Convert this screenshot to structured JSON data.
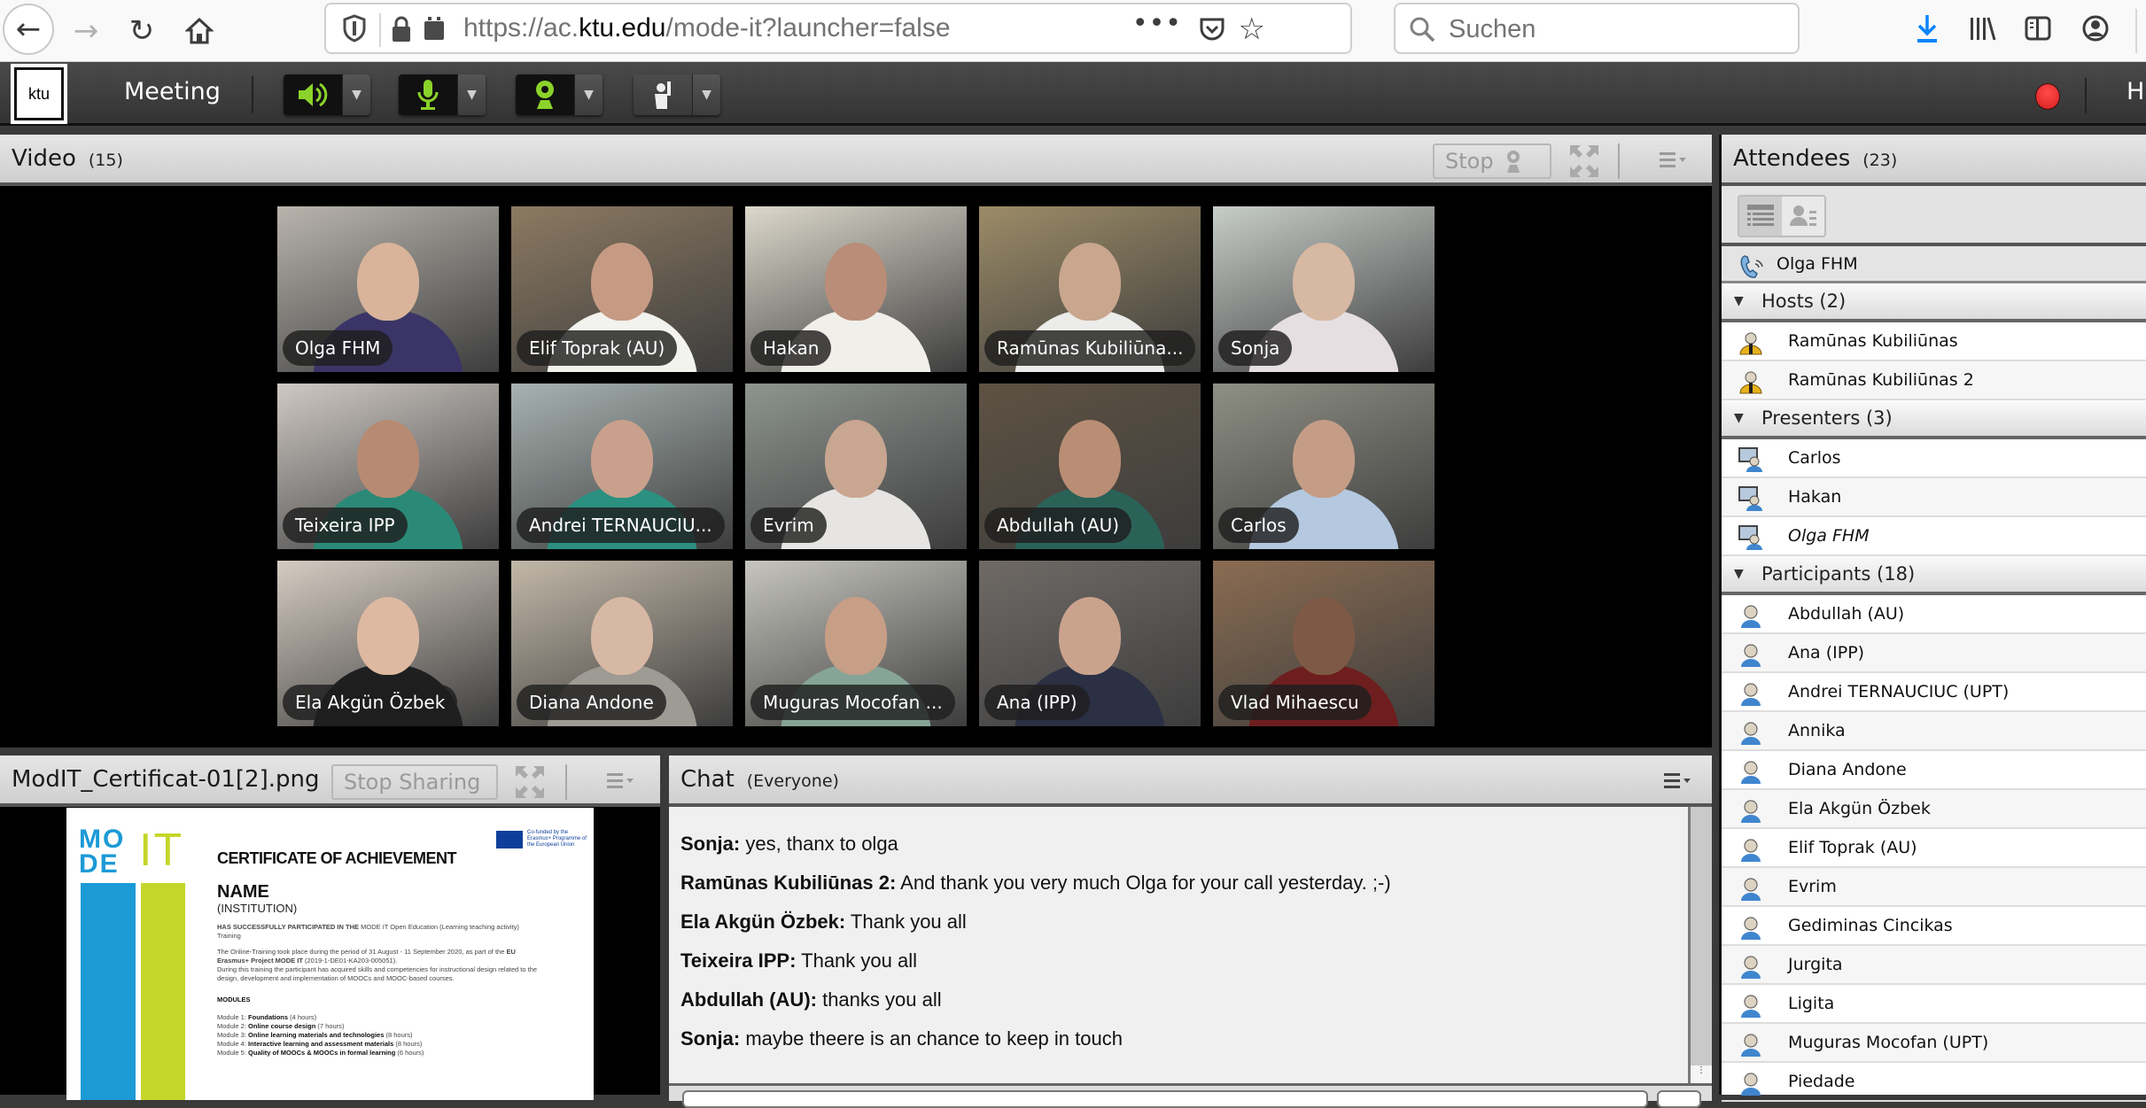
{
  "browser": {
    "url_prefix": "https://ac.",
    "url_domain": "ktu.edu",
    "url_path": "/mode-it?launcher=false",
    "more_label": "•••",
    "search_placeholder": "Suchen"
  },
  "meeting_bar": {
    "logo_text": "ktu",
    "menu_meeting": "Meeting",
    "menu_help": "H",
    "status_colors": {
      "active": "#8bd32a",
      "recording": "#e02a2a"
    }
  },
  "video_pod": {
    "title": "Video",
    "count": "(15)",
    "stop_label": "Stop",
    "tiles": [
      {
        "name": "Olga FHM",
        "bg": "#b9b4ad",
        "skin": "#d9b49a",
        "shirt": "#3a3566"
      },
      {
        "name": "Elif Toprak (AU)",
        "bg": "#8c7a62",
        "skin": "#c79a84",
        "shirt": "#f2f2ee"
      },
      {
        "name": "Hakan",
        "bg": "#dcd8cc",
        "skin": "#b98d77",
        "shirt": "#f0efea"
      },
      {
        "name": "Ramūnas Kubiliūna...",
        "bg": "#9c8b67",
        "skin": "#c9a68e",
        "shirt": "#ececea"
      },
      {
        "name": "Sonja",
        "bg": "#c7cdc8",
        "skin": "#d7b8a2",
        "shirt": "#e6dfe2"
      },
      {
        "name": "Teixeira IPP",
        "bg": "#cfc9c4",
        "skin": "#b88a72",
        "shirt": "#2b8a77"
      },
      {
        "name": "Andrei TERNAUCIU...",
        "bg": "#a7b2b0",
        "skin": "#c9a08c",
        "shirt": "#2b9080"
      },
      {
        "name": "Evrim",
        "bg": "#8e9590",
        "skin": "#c8a690",
        "shirt": "#e7e5e3"
      },
      {
        "name": "Abdullah (AU)",
        "bg": "#5e5242",
        "skin": "#b98e74",
        "shirt": "#2b6258"
      },
      {
        "name": "Carlos",
        "bg": "#8e8f84",
        "skin": "#c59d86",
        "shirt": "#b4c8df"
      },
      {
        "name": "Ela Akgün Özbek",
        "bg": "#d5ccc2",
        "skin": "#ddb9a1",
        "shirt": "#1f1f1f"
      },
      {
        "name": "Diana Andone",
        "bg": "#c2b8a8",
        "skin": "#d7b8a4",
        "shirt": "#9e9a94"
      },
      {
        "name": "Muguras Mocofan ...",
        "bg": "#c6c5be",
        "skin": "#c79e86",
        "shirt": "#86a497"
      },
      {
        "name": "Ana (IPP)",
        "bg": "#6f6a66",
        "skin": "#caa38d",
        "shirt": "#2c3045"
      },
      {
        "name": "Vlad Mihaescu",
        "bg": "#8b6c52",
        "skin": "#7e5a46",
        "shirt": "#6e1e1e"
      }
    ]
  },
  "share_pod": {
    "title": "ModIT_Certificat-01[2].png",
    "stop_sharing_label": "Stop Sharing",
    "certificate": {
      "logo_line1": "MO",
      "logo_line2": "DE",
      "logo_it": "IT",
      "eu_text": "Co-funded by the Erasmus+ Programme of the European Union",
      "title": "CERTIFICATE OF ACHIEVEMENT",
      "name": "NAME",
      "institution": "(INSTITUTION)",
      "participated_bold": "HAS SUCCESSFULLY PARTICIPATED IN THE",
      "participated_rest": " MODE IT Open Education (Learning teaching activity) Training",
      "period_text": "The Online-Training took place during the period of 31 August - 11 September 2020, as part of the ",
      "project_bold": "EU Erasmus+ Project MODE IT",
      "project_code": " (2019-1-DE01-KA203-005051).",
      "acquired_text": "During this training the participant has acquired skills and competencies for instructional design related to the design, development and implementation of MOOCs and MOOC-based courses.",
      "modules_heading": "MODULES",
      "modules": [
        {
          "prefix": "Module 1: ",
          "name": "Foundations",
          "hours": " (4 hours)"
        },
        {
          "prefix": "Module 2: ",
          "name": "Online course design",
          "hours": " (7 hours)"
        },
        {
          "prefix": "Module 3: ",
          "name": "Online learning materials and technologies",
          "hours": " (8 hours)"
        },
        {
          "prefix": "Module 4: ",
          "name": "Interactive learning and assessment materials",
          "hours": " (8 hours)"
        },
        {
          "prefix": "Module 5: ",
          "name": "Quality of MOOCs & MOOCs in formal learning",
          "hours": " (6 hours)"
        }
      ],
      "colors": {
        "blue": "#1c9ad6",
        "green": "#c5d62b"
      }
    }
  },
  "chat_pod": {
    "title": "Chat",
    "scope": "(Everyone)",
    "messages": [
      {
        "sender": "Sonja:",
        "text": " yes, thanx to olga"
      },
      {
        "sender": "Ramūnas Kubiliūnas 2:",
        "text": " And thank you very much Olga for your call yesterday. ;-)"
      },
      {
        "sender": "Ela Akgün Özbek:",
        "text": " Thank you all"
      },
      {
        "sender": "Teixeira IPP:",
        "text": " Thank you all"
      },
      {
        "sender": "Abdullah (AU):",
        "text": " thanks you all"
      },
      {
        "sender": "Sonja:",
        "text": " maybe theere is an chance to keep in touch"
      }
    ]
  },
  "attendees_pod": {
    "title": "Attendees",
    "count": "(23)",
    "phone_user": "Olga FHM",
    "groups": [
      {
        "label": "Hosts (2)",
        "role": "host",
        "members": [
          "Ramūnas Kubiliūnas",
          "Ramūnas Kubiliūnas 2"
        ]
      },
      {
        "label": "Presenters (3)",
        "role": "presenter",
        "members": [
          "Carlos",
          "Hakan",
          "Olga FHM"
        ]
      },
      {
        "label": "Participants (18)",
        "role": "participant",
        "members": [
          "Abdullah (AU)",
          "Ana (IPP)",
          "Andrei TERNAUCIUC (UPT)",
          "Annika",
          "Diana Andone",
          "Ela Akgün Özbek",
          "Elif Toprak (AU)",
          "Evrim",
          "Gediminas Cincikas",
          "Jurgita",
          "Ligita",
          "Muguras Mocofan (UPT)",
          "Piedade"
        ]
      }
    ]
  }
}
